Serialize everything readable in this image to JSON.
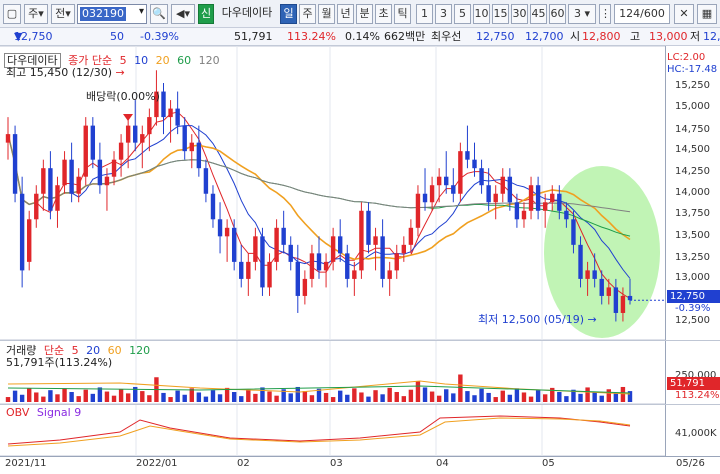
{
  "toolbar": {
    "market_label": "주",
    "period_label": "전",
    "code_value": "032190",
    "badge_new": "신",
    "stock_name": "다우데이타",
    "intervals": [
      "일",
      "주",
      "월",
      "년",
      "분",
      "초",
      "틱"
    ],
    "numbers": [
      "1",
      "3",
      "5",
      "10",
      "15",
      "30",
      "45",
      "60"
    ],
    "count_select": "3",
    "page_counter": "124/600"
  },
  "info": {
    "price": "12,750",
    "change": "50",
    "change_pct": "-0.39%",
    "volume": "51,791",
    "volume_pct": "113.24%",
    "turnover": "0.14%",
    "amount": "662백만",
    "best_sell_label": "최우선",
    "best_sell": "12,750",
    "best_buy": "12,700",
    "open_label": "시",
    "open": "12,800",
    "high_label": "고",
    "high": "13,000",
    "low_label": "저",
    "low": "12,"
  },
  "price_panel": {
    "title": "다우데이타",
    "ma_label": "종가 단순",
    "ma_periods": [
      "5",
      "10",
      "20",
      "60",
      "120"
    ],
    "ma_colors": [
      "#e0262a",
      "#2040d0",
      "#f0a020",
      "#1f9d4a",
      "#808080"
    ],
    "lc_label": "LC:2.00",
    "hc_label": "HC:-17.48",
    "high_note": "최고 15,450 (12/30)",
    "dividend_note": "배당락(0.00%)",
    "low_note": "최저 12,500 (05/19)",
    "y_ticks": [
      "15,250",
      "15,000",
      "14,750",
      "14,500",
      "14,250",
      "14,000",
      "13,750",
      "13,500",
      "13,250",
      "13,000",
      "12,500"
    ],
    "current_tag": "12,750",
    "current_pct": "-0.39%"
  },
  "volume_panel": {
    "title": "거래량",
    "ma_label": "단순",
    "ma_periods": [
      "5",
      "20",
      "60",
      "120"
    ],
    "value_line": "51,791주(113.24%)",
    "tick": "250,000",
    "tag": "51,791",
    "tag_pct": "113.24%"
  },
  "obv_panel": {
    "title": "OBV",
    "signal": "Signal 9",
    "tick": "41,000K"
  },
  "x_axis": [
    "2021/11",
    "2022/01",
    "02",
    "03",
    "04",
    "05",
    "05/26"
  ],
  "colors": {
    "up": "#e0262a",
    "down": "#2040d0",
    "highlight": "#b6f2a8"
  },
  "chart_data": {
    "type": "candlestick",
    "ylim": [
      12400,
      15500
    ],
    "ohlc": [
      [
        14600,
        14900,
        14400,
        14700
      ],
      [
        14700,
        14800,
        13900,
        14000
      ],
      [
        14000,
        14200,
        12900,
        13100
      ],
      [
        13200,
        13800,
        13100,
        13700
      ],
      [
        13700,
        14100,
        13600,
        14000
      ],
      [
        14000,
        14400,
        13800,
        14300
      ],
      [
        14300,
        14500,
        13700,
        13800
      ],
      [
        13800,
        14200,
        13600,
        14100
      ],
      [
        14100,
        14500,
        14000,
        14400
      ],
      [
        14400,
        14600,
        13900,
        14000
      ],
      [
        14000,
        14300,
        13900,
        14200
      ],
      [
        14200,
        14900,
        14100,
        14800
      ],
      [
        14800,
        14900,
        14300,
        14400
      ],
      [
        14400,
        14600,
        14000,
        14100
      ],
      [
        14100,
        14300,
        13800,
        14200
      ],
      [
        14200,
        14500,
        14100,
        14400
      ],
      [
        14400,
        14700,
        14200,
        14600
      ],
      [
        14600,
        14900,
        14300,
        14800
      ],
      [
        14800,
        15100,
        14500,
        14600
      ],
      [
        14600,
        14800,
        14300,
        14700
      ],
      [
        14700,
        15000,
        14500,
        14900
      ],
      [
        14900,
        15450,
        14800,
        15200
      ],
      [
        15200,
        15300,
        14700,
        14900
      ],
      [
        14900,
        15100,
        14600,
        15000
      ],
      [
        15000,
        15200,
        14700,
        14800
      ],
      [
        14800,
        14900,
        14400,
        14500
      ],
      [
        14500,
        14700,
        14300,
        14600
      ],
      [
        14600,
        14800,
        14200,
        14300
      ],
      [
        14300,
        14400,
        13900,
        14000
      ],
      [
        14000,
        14100,
        13600,
        13700
      ],
      [
        13700,
        13900,
        13300,
        13500
      ],
      [
        13500,
        13700,
        13200,
        13600
      ],
      [
        13600,
        13700,
        13100,
        13200
      ],
      [
        13200,
        13400,
        12900,
        13000
      ],
      [
        13000,
        13300,
        12800,
        13200
      ],
      [
        13200,
        13600,
        13100,
        13500
      ],
      [
        13500,
        13600,
        12800,
        12900
      ],
      [
        12900,
        13300,
        12800,
        13200
      ],
      [
        13200,
        13700,
        13100,
        13600
      ],
      [
        13600,
        13800,
        13300,
        13400
      ],
      [
        13400,
        13500,
        13100,
        13200
      ],
      [
        13200,
        13400,
        12600,
        12800
      ],
      [
        12800,
        13100,
        12700,
        13000
      ],
      [
        13000,
        13400,
        12900,
        13300
      ],
      [
        13300,
        13500,
        13000,
        13100
      ],
      [
        13100,
        13300,
        12900,
        13200
      ],
      [
        13200,
        13600,
        13100,
        13500
      ],
      [
        13500,
        13700,
        13200,
        13300
      ],
      [
        13300,
        13400,
        12900,
        13000
      ],
      [
        13000,
        13200,
        12800,
        13100
      ],
      [
        13100,
        13900,
        13000,
        13800
      ],
      [
        13800,
        13900,
        13300,
        13400
      ],
      [
        13400,
        13600,
        13100,
        13500
      ],
      [
        13500,
        13700,
        12900,
        13000
      ],
      [
        13000,
        13200,
        12800,
        13100
      ],
      [
        13100,
        13400,
        13000,
        13300
      ],
      [
        13300,
        13500,
        13200,
        13400
      ],
      [
        13400,
        13700,
        13300,
        13600
      ],
      [
        13600,
        14100,
        13500,
        14000
      ],
      [
        14000,
        14300,
        13800,
        13900
      ],
      [
        13900,
        14200,
        13800,
        14100
      ],
      [
        14100,
        14300,
        13900,
        14200
      ],
      [
        14200,
        14500,
        14000,
        14100
      ],
      [
        14100,
        14300,
        13900,
        14000
      ],
      [
        14000,
        14600,
        13900,
        14500
      ],
      [
        14500,
        14800,
        14300,
        14400
      ],
      [
        14400,
        14600,
        14200,
        14300
      ],
      [
        14300,
        14400,
        14000,
        14100
      ],
      [
        14100,
        14300,
        13800,
        13900
      ],
      [
        13900,
        14100,
        13700,
        14000
      ],
      [
        14000,
        14300,
        13900,
        14200
      ],
      [
        14200,
        14300,
        13800,
        13900
      ],
      [
        13900,
        14000,
        13600,
        13700
      ],
      [
        13700,
        13900,
        13600,
        13800
      ],
      [
        13800,
        14200,
        13700,
        14100
      ],
      [
        14100,
        14200,
        13700,
        13800
      ],
      [
        13800,
        14000,
        13600,
        13900
      ],
      [
        13900,
        14100,
        13800,
        14000
      ],
      [
        14000,
        14100,
        13700,
        13800
      ],
      [
        13800,
        13900,
        13600,
        13700
      ],
      [
        13700,
        13800,
        13300,
        13400
      ],
      [
        13400,
        13500,
        12900,
        13000
      ],
      [
        13000,
        13200,
        12800,
        13100
      ],
      [
        13100,
        13300,
        12900,
        13000
      ],
      [
        13000,
        13100,
        12700,
        12800
      ],
      [
        12800,
        13000,
        12700,
        12900
      ],
      [
        12900,
        13000,
        12500,
        12600
      ],
      [
        12600,
        12900,
        12500,
        12800
      ],
      [
        12800,
        13000,
        12700,
        12750
      ]
    ]
  }
}
